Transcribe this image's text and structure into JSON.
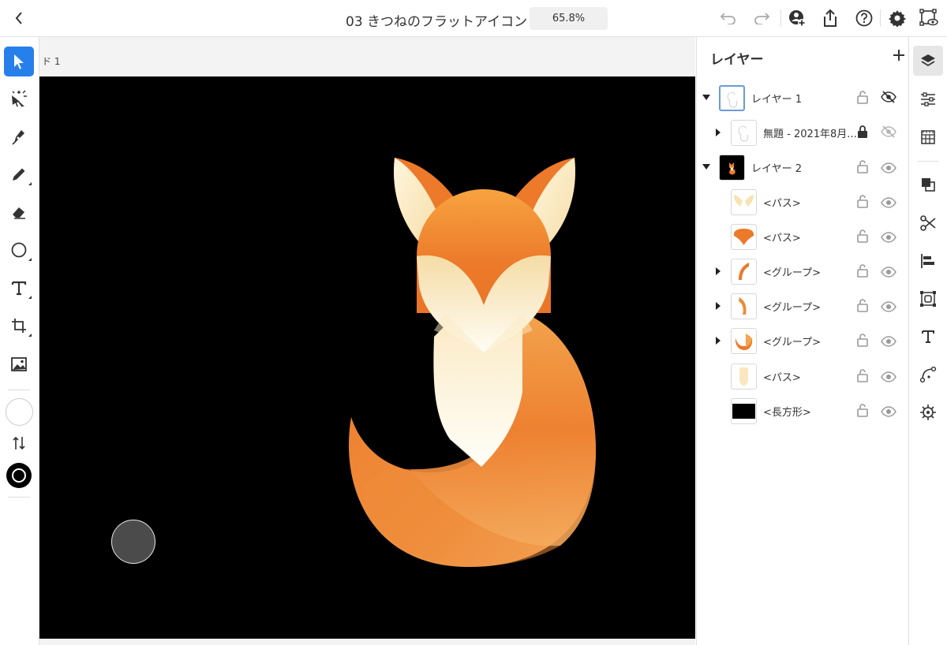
{
  "header": {
    "title": "03 きつねのフラットアイコン",
    "zoom": "65.8%"
  },
  "canvas": {
    "artboard_label": "ド 1",
    "background_color": "#000000"
  },
  "layers_panel": {
    "title": "レイヤー",
    "items": [
      {
        "label": "レイヤー 1",
        "thumb": "sketch",
        "expanded": true,
        "locked": false,
        "hidden": true
      },
      {
        "label": "無題 - 2021年8月...",
        "thumb": "sketch",
        "expanded": false,
        "locked": true,
        "hidden": true
      },
      {
        "label": "レイヤー 2",
        "thumb": "fox-black",
        "expanded": true,
        "locked": false,
        "hidden": false
      },
      {
        "label": "<パス>",
        "thumb": "ears",
        "locked": false,
        "hidden": false
      },
      {
        "label": "<パス>",
        "thumb": "head",
        "locked": false,
        "hidden": false
      },
      {
        "label": "<グループ>",
        "thumb": "shape-a",
        "expanded": false,
        "locked": false,
        "hidden": false
      },
      {
        "label": "<グループ>",
        "thumb": "shape-b",
        "expanded": false,
        "locked": false,
        "hidden": false
      },
      {
        "label": "<グループ>",
        "thumb": "tail",
        "expanded": false,
        "locked": false,
        "hidden": false
      },
      {
        "label": "<パス>",
        "thumb": "body",
        "locked": false,
        "hidden": false
      },
      {
        "label": "<長方形>",
        "thumb": "rect-black",
        "locked": false,
        "hidden": false
      }
    ]
  },
  "colors": {
    "accent": "#2680eb",
    "fox_orange": "#ec7a2a",
    "fox_cream": "#fdf4d8"
  }
}
